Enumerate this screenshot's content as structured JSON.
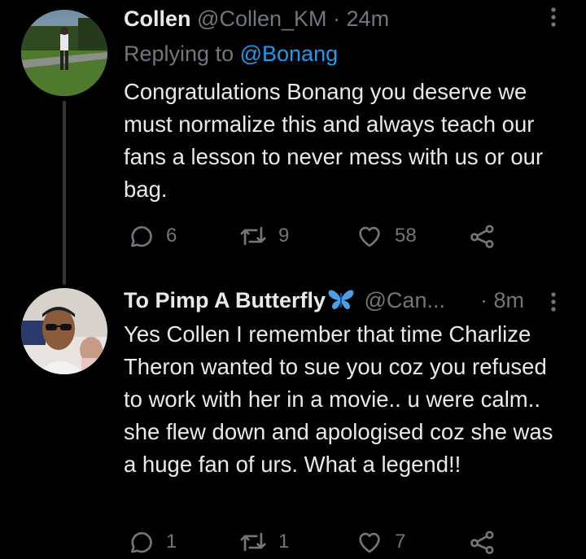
{
  "tweets": [
    {
      "name": "Collen",
      "handle": "@Collen_KM",
      "separator": "·",
      "time": "24m",
      "replying_prefix": "Replying to",
      "replying_to": "@Bonang",
      "text": "Congratulations Bonang you deserve we must normalize this and always teach our fans a lesson to never mess with us or our bag.",
      "replies": "6",
      "retweets": "9",
      "likes": "58"
    },
    {
      "name": "To Pimp A Butterfly",
      "name_emoji": "butterfly-emoji",
      "handle": "@Can...",
      "separator": "·",
      "time": "8m",
      "text": "Yes Collen I remember that time Charlize Theron wanted to sue you coz you refused to work with her in a movie.. u were calm.. she flew down and apologised coz she was a huge fan of urs. What a legend!!",
      "replies": "1",
      "retweets": "1",
      "likes": "7"
    }
  ],
  "icons": {
    "reply": "reply-icon",
    "retweet": "retweet-icon",
    "like": "heart-icon",
    "share": "share-icon",
    "more": "more-icon"
  },
  "colors": {
    "background": "#000000",
    "text": "#e7e9ea",
    "secondary": "#71767b",
    "link": "#1d9bf0",
    "thread_line": "#333639"
  }
}
